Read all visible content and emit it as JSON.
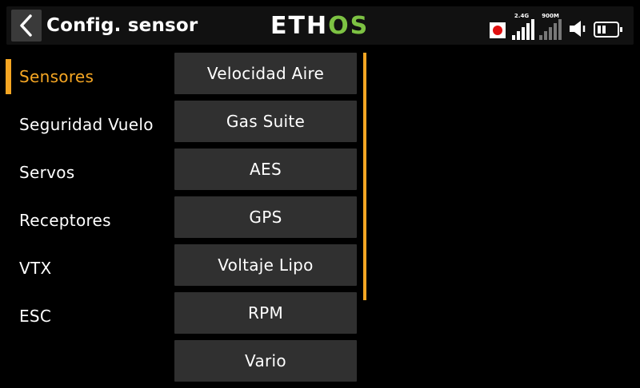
{
  "header": {
    "title": "Config. sensor",
    "logo_white": "ETH",
    "logo_green": "OS",
    "signal_24_label": "2.4G",
    "signal_900_label": "900M",
    "accent": "#f5a623",
    "logo_green_color": "#7dc243"
  },
  "menu": {
    "items": [
      {
        "label": "Sensores",
        "active": true
      },
      {
        "label": "Seguridad Vuelo"
      },
      {
        "label": "Servos"
      },
      {
        "label": "Receptores"
      },
      {
        "label": "VTX"
      },
      {
        "label": "ESC"
      }
    ]
  },
  "sensors": {
    "items": [
      {
        "label": "Velocidad Aire"
      },
      {
        "label": "Gas Suite"
      },
      {
        "label": "AES"
      },
      {
        "label": "GPS"
      },
      {
        "label": "Voltaje Lipo"
      },
      {
        "label": "RPM"
      },
      {
        "label": "Vario"
      }
    ]
  },
  "icons": {
    "back": "chevron-left-icon",
    "record": "record-icon",
    "signal": "signal-bars-icon",
    "volume": "speaker-icon",
    "battery": "battery-icon"
  }
}
